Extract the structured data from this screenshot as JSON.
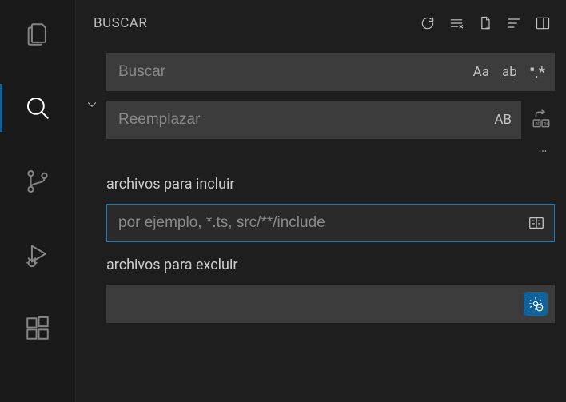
{
  "panel": {
    "title": "BUSCAR"
  },
  "search": {
    "placeholder": "Buscar",
    "case_label": "Aa",
    "word_label": "ab",
    "regex_label": ".*"
  },
  "replace": {
    "placeholder": "Reemplazar",
    "preserve_label": "AB"
  },
  "include": {
    "label": "archivos para incluir",
    "placeholder": "por ejemplo, *.ts, src/**/include"
  },
  "exclude": {
    "label": "archivos para excluir",
    "placeholder": ""
  }
}
